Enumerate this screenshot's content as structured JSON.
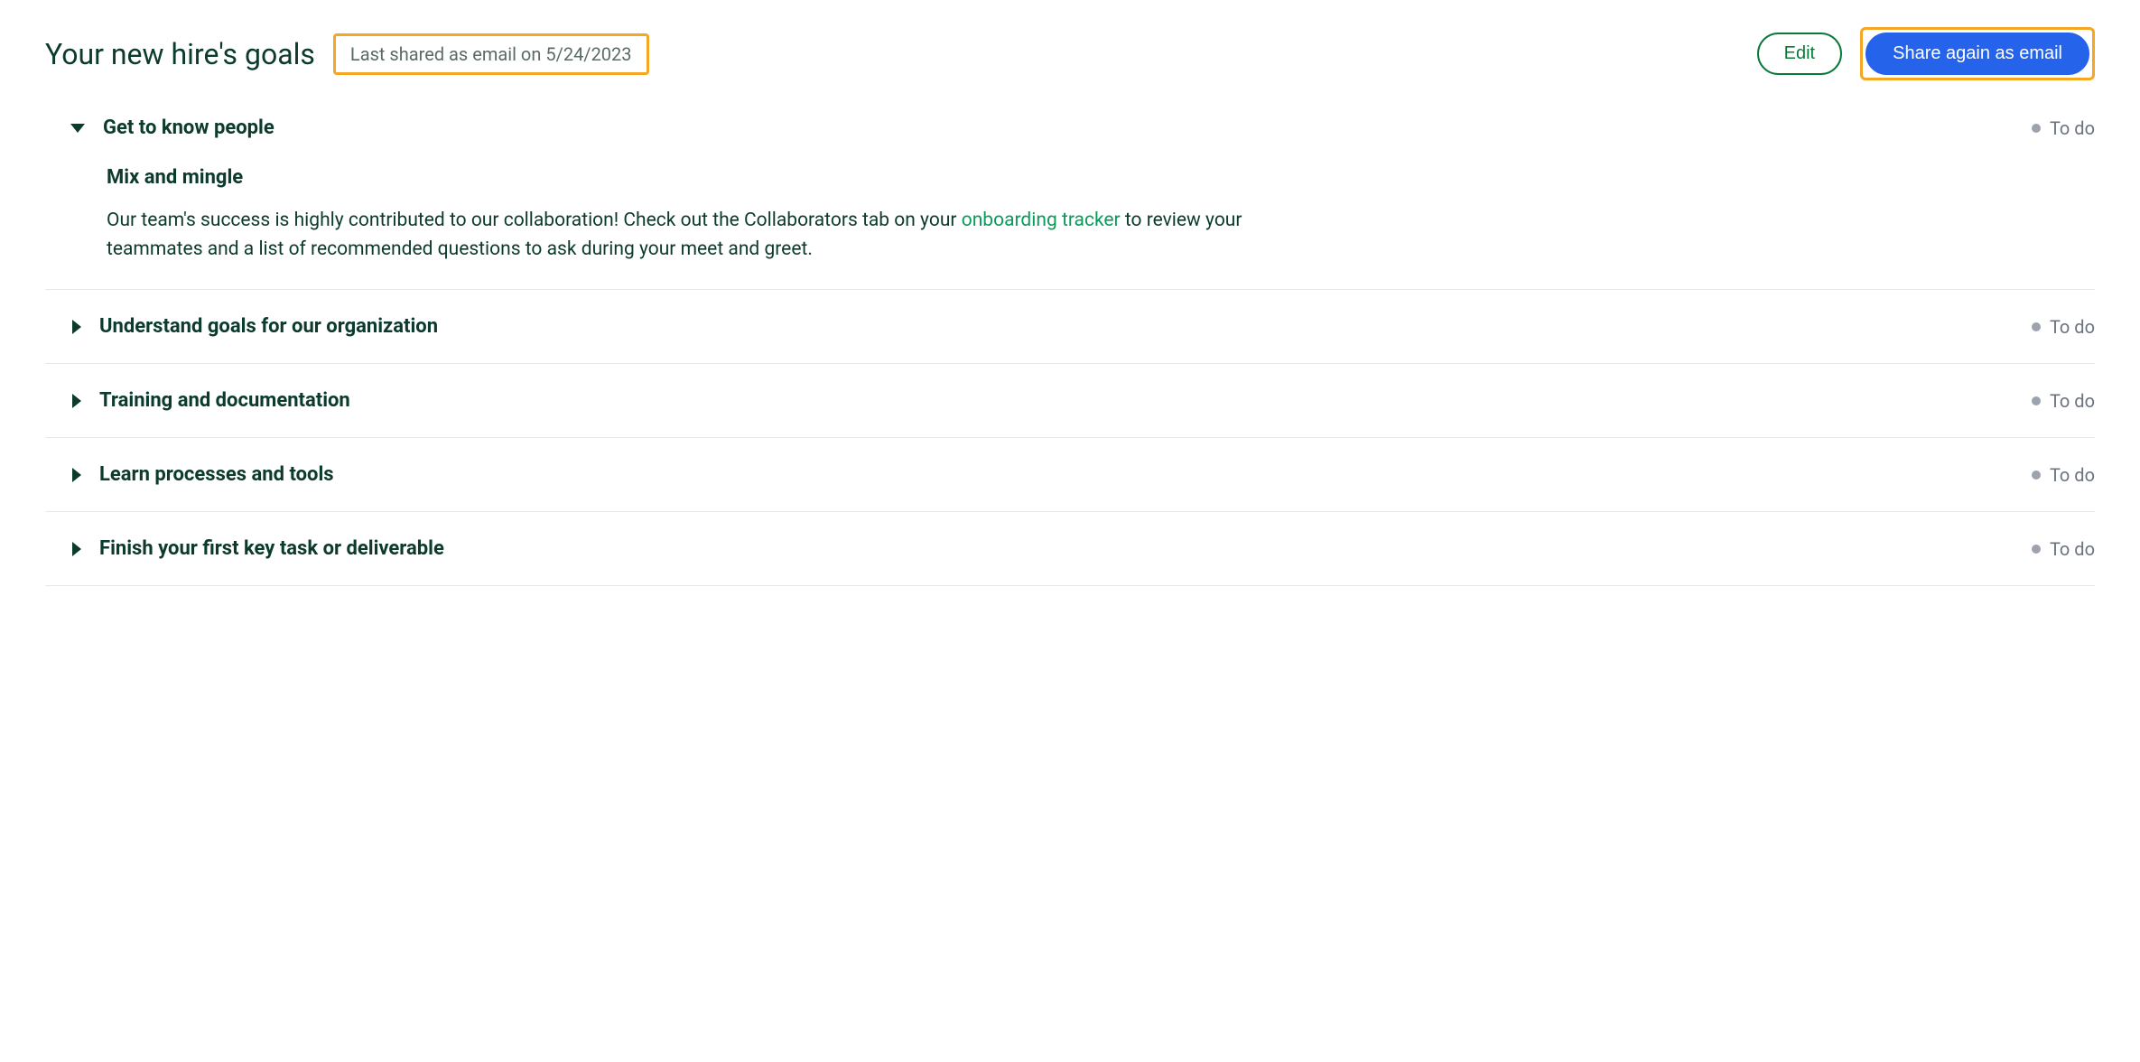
{
  "header": {
    "title": "Your new hire's goals",
    "last_shared": "Last shared as email on 5/24/2023",
    "edit_label": "Edit",
    "share_label": "Share again as email"
  },
  "status_label": "To do",
  "goals": [
    {
      "title": "Get to know people",
      "expanded": true,
      "subtitle": "Mix and mingle",
      "desc_pre": "Our team's success is highly contributed to our collaboration! Check out the Collaborators tab on your ",
      "desc_link": "onboarding tracker",
      "desc_post": " to review your teammates and a list of recommended questions to ask during your meet and greet."
    },
    {
      "title": "Understand goals for our organization",
      "expanded": false
    },
    {
      "title": "Training and documentation",
      "expanded": false
    },
    {
      "title": "Learn processes and tools",
      "expanded": false
    },
    {
      "title": "Finish your first key task or deliverable",
      "expanded": false
    }
  ]
}
